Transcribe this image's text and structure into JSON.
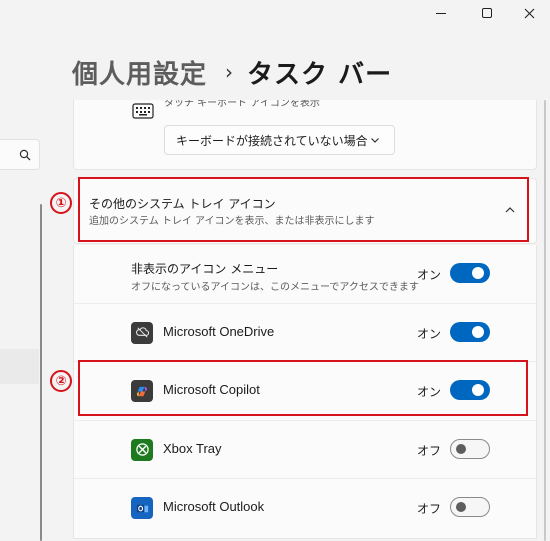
{
  "window": {
    "minimize_icon": "minimize-icon",
    "maximize_icon": "maximize-icon",
    "close_icon": "close-icon"
  },
  "sidebar": {
    "search_icon": "search-icon"
  },
  "breadcrumb": {
    "parent": "個人用設定",
    "separator": "›",
    "current": "タスク バー"
  },
  "touch_keyboard": {
    "label": "タッチ キーボード アイコンを表示",
    "icon": "keyboard-icon",
    "dropdown_value": "キーボードが接続されていない場合"
  },
  "tray_section": {
    "title": "その他のシステム トレイ アイコン",
    "subtitle": "追加のシステム トレイ アイコンを表示、または非表示にします",
    "expanded": true
  },
  "hidden_menu": {
    "title": "非表示のアイコン メニュー",
    "description": "オフになっているアイコンは、このメニューでアクセスできます",
    "state": "オン",
    "on": true
  },
  "apps": [
    {
      "name": "Microsoft OneDrive",
      "icon": "onedrive-icon",
      "state": "オン",
      "on": true,
      "color": "#3b3b3b"
    },
    {
      "name": "Microsoft Copilot",
      "icon": "copilot-icon",
      "state": "オン",
      "on": true,
      "color": "#3b3b3b"
    },
    {
      "name": "Xbox Tray",
      "icon": "xbox-icon",
      "state": "オフ",
      "on": false,
      "color": "#1e7a1e"
    },
    {
      "name": "Microsoft Outlook",
      "icon": "outlook-icon",
      "state": "オフ",
      "on": false,
      "color": "#1565c0"
    }
  ],
  "annotations": {
    "mark1": "①",
    "mark2": "②",
    "color": "#d6121a"
  },
  "colors": {
    "accent": "#0067c0",
    "background": "#f3f3f3",
    "card": "#fbfbfb"
  }
}
